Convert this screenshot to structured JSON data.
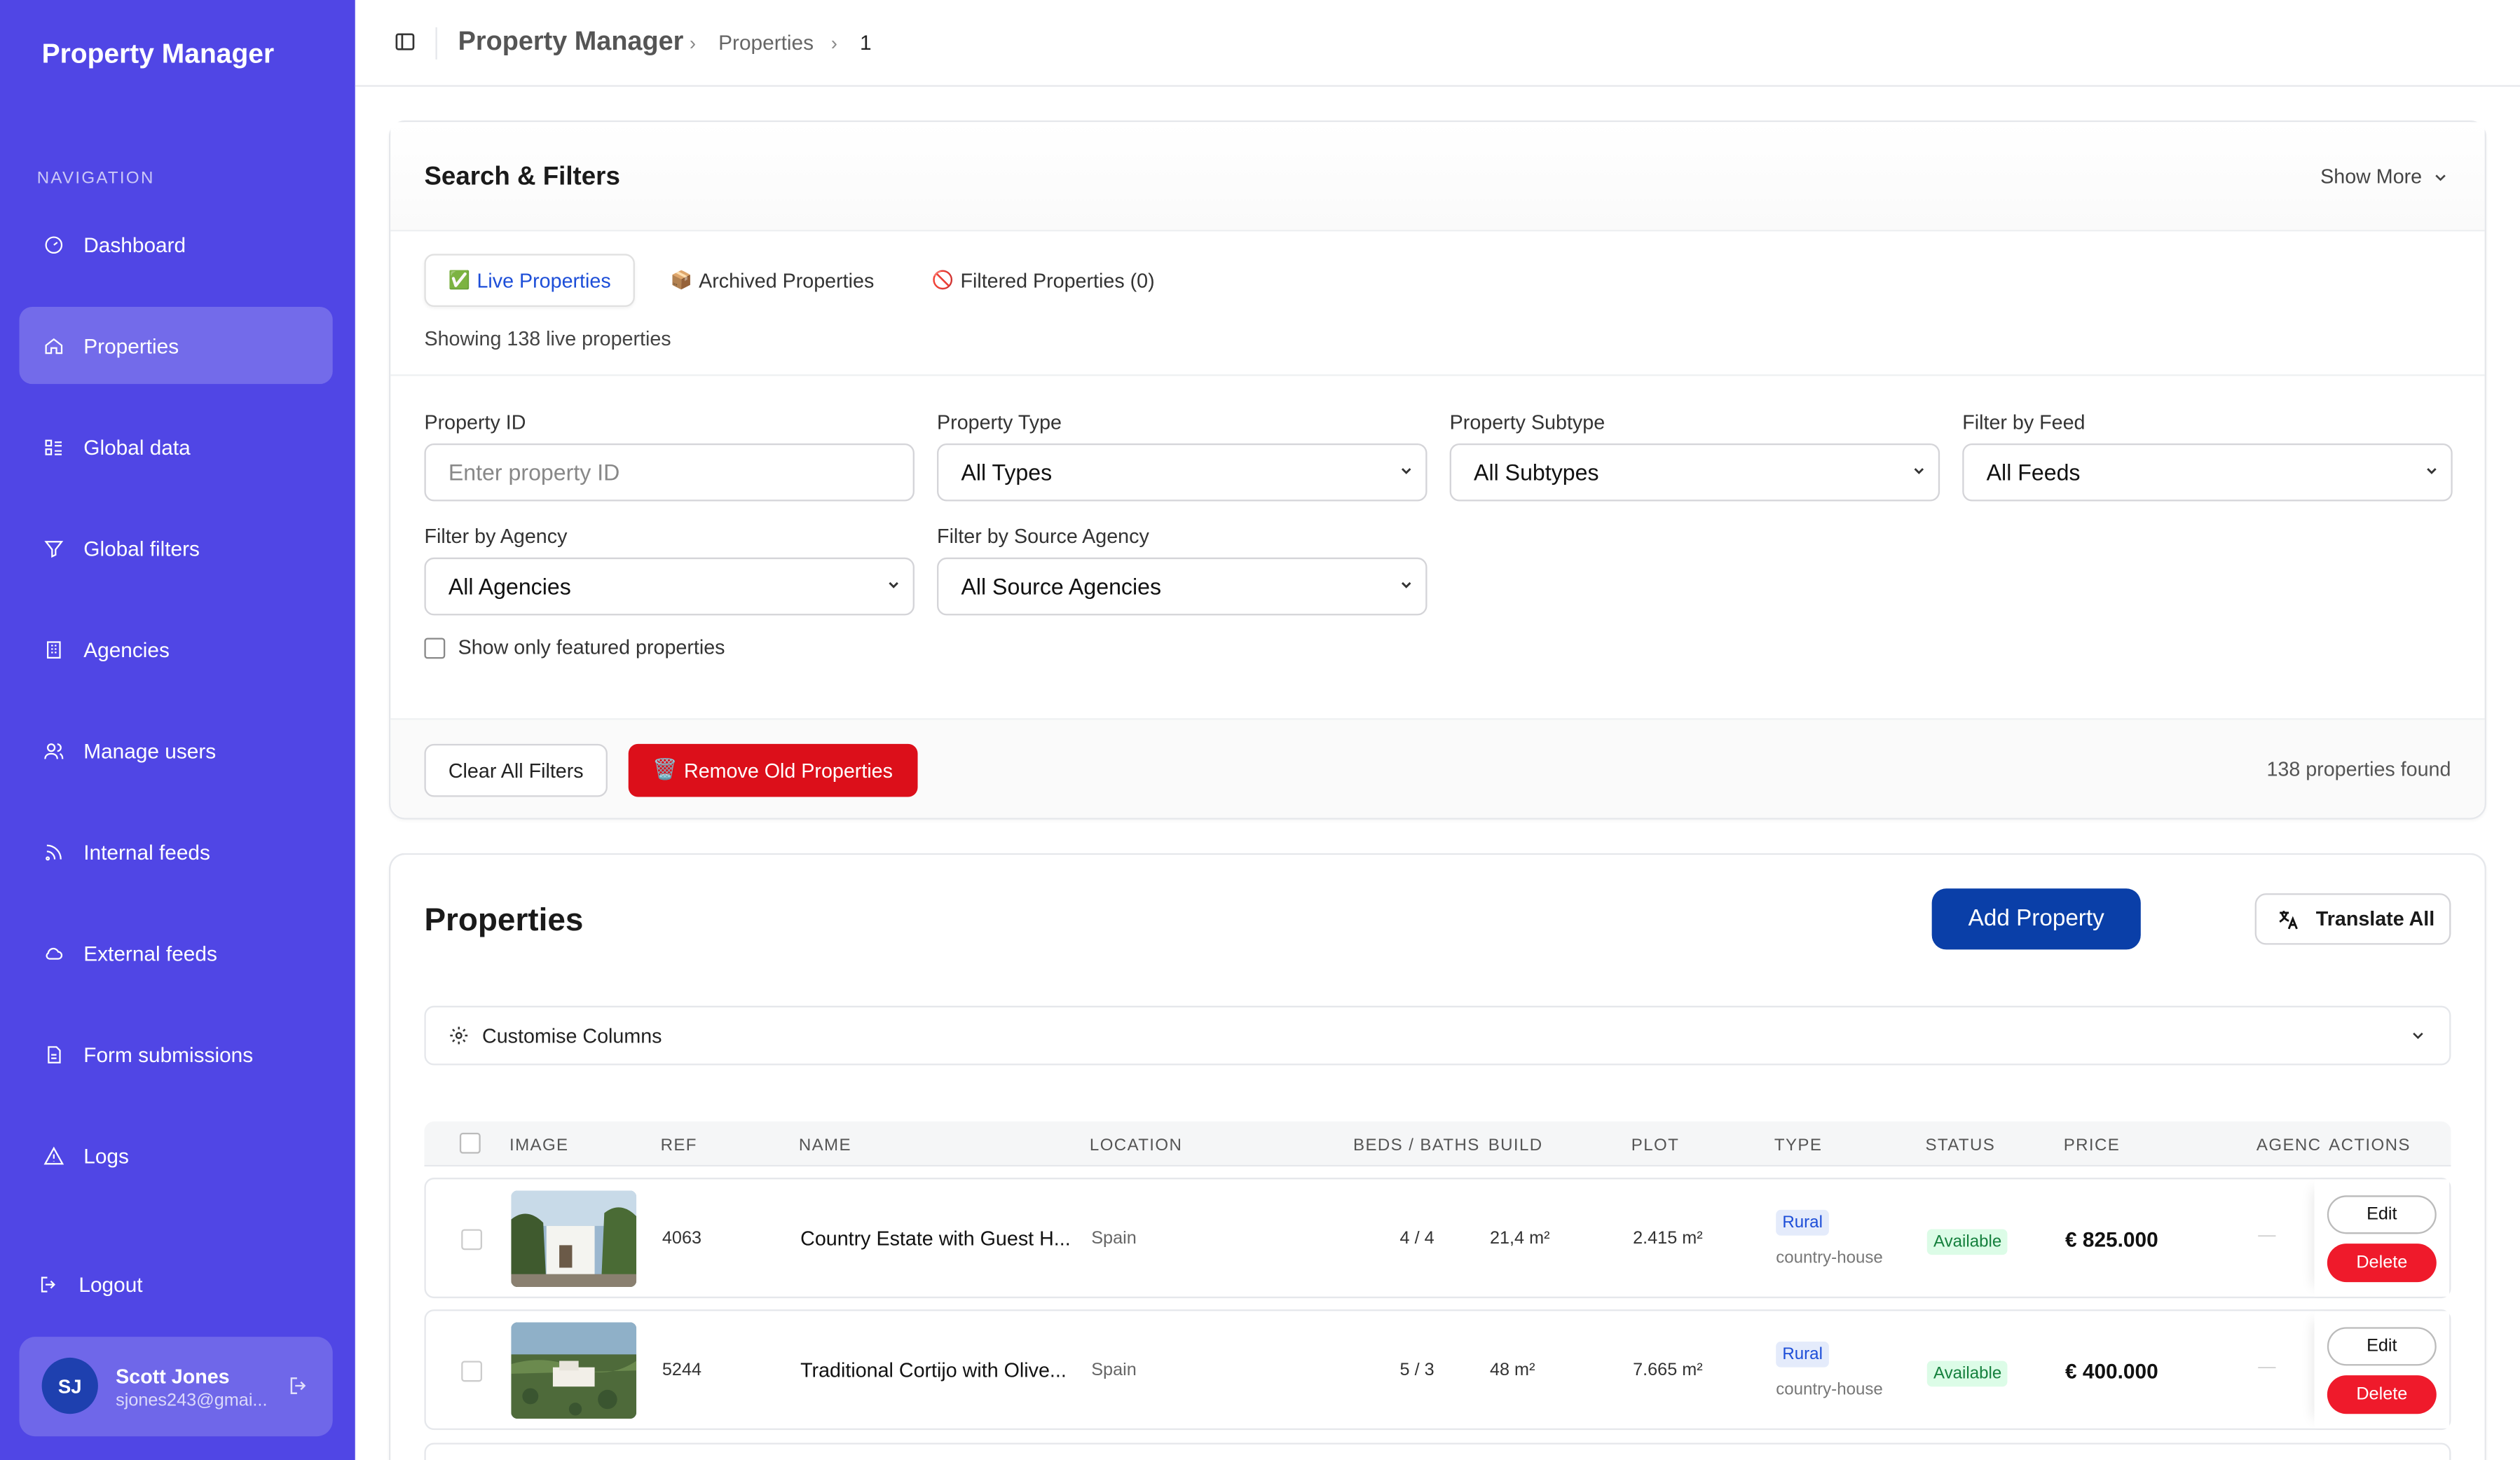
{
  "app": {
    "brand": "Property Manager",
    "nav_label": "NAVIGATION",
    "nav": [
      {
        "label": "Dashboard",
        "icon": "gauge-icon"
      },
      {
        "label": "Properties",
        "icon": "home-icon"
      },
      {
        "label": "Global data",
        "icon": "list-icon"
      },
      {
        "label": "Global filters",
        "icon": "filter-icon"
      },
      {
        "label": "Agencies",
        "icon": "building-icon"
      },
      {
        "label": "Manage users",
        "icon": "users-icon"
      },
      {
        "label": "Internal feeds",
        "icon": "rss-icon"
      },
      {
        "label": "External feeds",
        "icon": "cloud-icon"
      },
      {
        "label": "Form submissions",
        "icon": "file-icon"
      },
      {
        "label": "Logs",
        "icon": "warning-icon"
      }
    ],
    "logout": "Logout",
    "user": {
      "initials": "SJ",
      "name": "Scott Jones",
      "email": "sjones243@gmai..."
    }
  },
  "breadcrumb": {
    "root": "Property Manager",
    "section": "Properties",
    "page": "1"
  },
  "filters": {
    "title": "Search & Filters",
    "show_more": "Show More",
    "tabs": [
      {
        "emoji": "✅",
        "label": "Live Properties"
      },
      {
        "emoji": "📦",
        "label": "Archived Properties"
      },
      {
        "emoji": "🚫",
        "label": "Filtered Properties (0)"
      }
    ],
    "showing": "Showing 138 live properties",
    "property_id": {
      "label": "Property ID",
      "placeholder": "Enter property ID"
    },
    "property_type": {
      "label": "Property Type",
      "value": "All Types"
    },
    "property_subtype": {
      "label": "Property Subtype",
      "value": "All Subtypes"
    },
    "feed": {
      "label": "Filter by Feed",
      "value": "All Feeds"
    },
    "agency": {
      "label": "Filter by Agency",
      "value": "All Agencies"
    },
    "source_agency": {
      "label": "Filter by Source Agency",
      "value": "All Source Agencies"
    },
    "featured": "Show only featured properties",
    "clear": "Clear All Filters",
    "remove_old": "Remove Old Properties",
    "remove_old_emoji": "🗑️",
    "found": "138 properties found"
  },
  "properties": {
    "title": "Properties",
    "add": "Add Property",
    "translate": "Translate All",
    "customise": "Customise Columns",
    "columns": [
      "IMAGE",
      "REF",
      "NAME",
      "LOCATION",
      "BEDS / BATHS",
      "BUILD",
      "PLOT",
      "TYPE",
      "STATUS",
      "PRICE",
      "AGENC",
      "ACTIONS"
    ],
    "rows": [
      {
        "ref": "4063",
        "name": "Country Estate with Guest H...",
        "location": "Spain",
        "beds_baths": "4 / 4",
        "build": "21,4 m²",
        "plot": "2.415 m²",
        "type": "Rural",
        "subtype": "country-house",
        "status": "Available",
        "price": "€ 825.000",
        "agency": "—",
        "edit": "Edit",
        "delete": "Delete"
      },
      {
        "ref": "5244",
        "name": "Traditional Cortijo with Olive...",
        "location": "Spain",
        "beds_baths": "5 / 3",
        "build": "48 m²",
        "plot": "7.665 m²",
        "type": "Rural",
        "subtype": "country-house",
        "status": "Available",
        "price": "€ 400.000",
        "agency": "—",
        "edit": "Edit",
        "delete": "Delete"
      }
    ]
  },
  "colors": {
    "sidebar": "#5046e5",
    "primary": "#0a3fa8",
    "danger": "#dc0f1a",
    "success": "#15803d"
  }
}
